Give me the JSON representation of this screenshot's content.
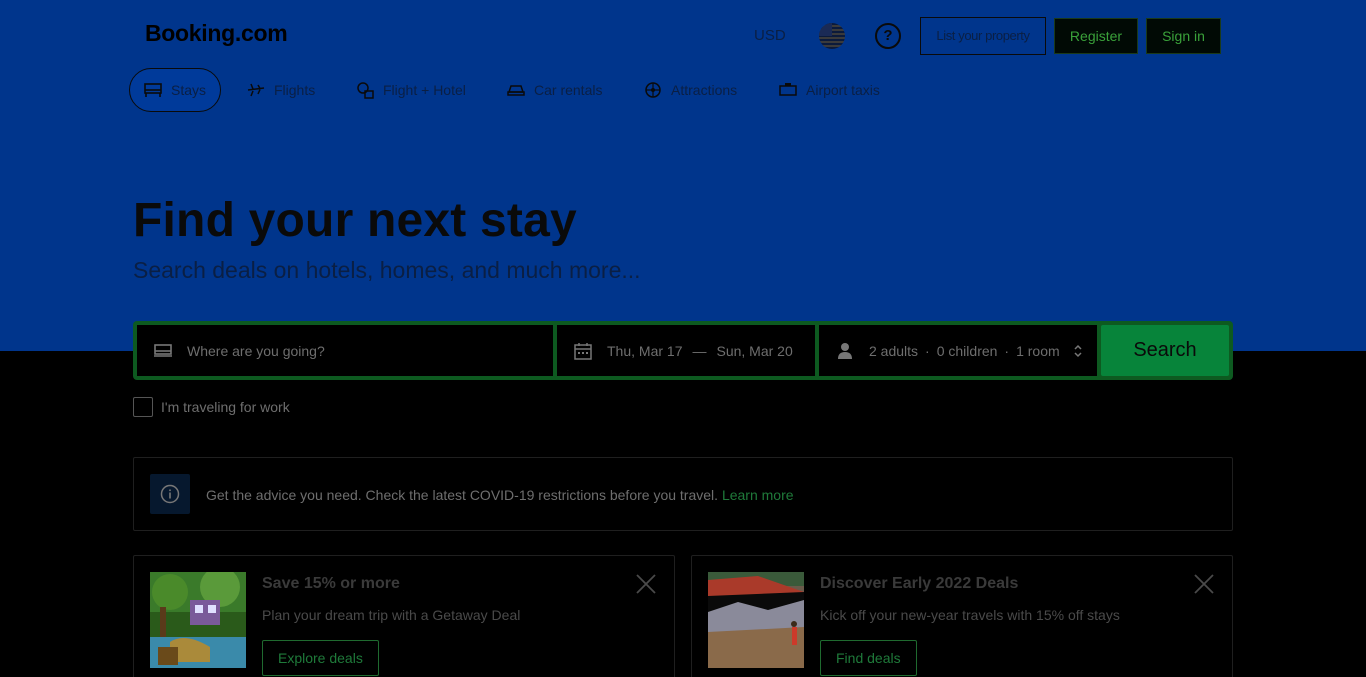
{
  "header": {
    "logo": "Booking.com",
    "currency": "USD",
    "list_property": "List your property",
    "register": "Register",
    "sign_in": "Sign in"
  },
  "nav": {
    "items": [
      {
        "label": "Stays",
        "icon": "bed-icon",
        "active": true
      },
      {
        "label": "Flights",
        "icon": "plane-icon",
        "active": false
      },
      {
        "label": "Flight + Hotel",
        "icon": "flight-hotel-icon",
        "active": false
      },
      {
        "label": "Car rentals",
        "icon": "car-icon",
        "active": false
      },
      {
        "label": "Attractions",
        "icon": "attractions-icon",
        "active": false
      },
      {
        "label": "Airport taxis",
        "icon": "taxi-icon",
        "active": false
      }
    ]
  },
  "hero": {
    "title": "Find your next stay",
    "subtitle": "Search deals on hotels, homes, and much more..."
  },
  "search": {
    "destination_placeholder": "Where are you going?",
    "checkin": "Thu, Mar 17",
    "separator": "—",
    "checkout": "Sun, Mar 20",
    "adults": "2 adults",
    "children": "0 children",
    "rooms": "1 room",
    "dot": "·",
    "button": "Search"
  },
  "work_travel": {
    "label": "I'm traveling for work"
  },
  "notice": {
    "text": "Get the advice you need. Check the latest COVID-19 restrictions before you travel.",
    "link": "Learn more"
  },
  "cards": [
    {
      "title": "Save 15% or more",
      "description": "Plan your dream trip with a Getaway Deal",
      "cta": "Explore deals"
    },
    {
      "title": "Discover Early 2022 Deals",
      "description": "Kick off your new-year travels with 15% off stays",
      "cta": "Find deals"
    }
  ],
  "colors": {
    "hero_bg": "#00358c",
    "search_border": "#0d5a20",
    "search_button": "#07843a",
    "link": "#1f7a3a"
  }
}
